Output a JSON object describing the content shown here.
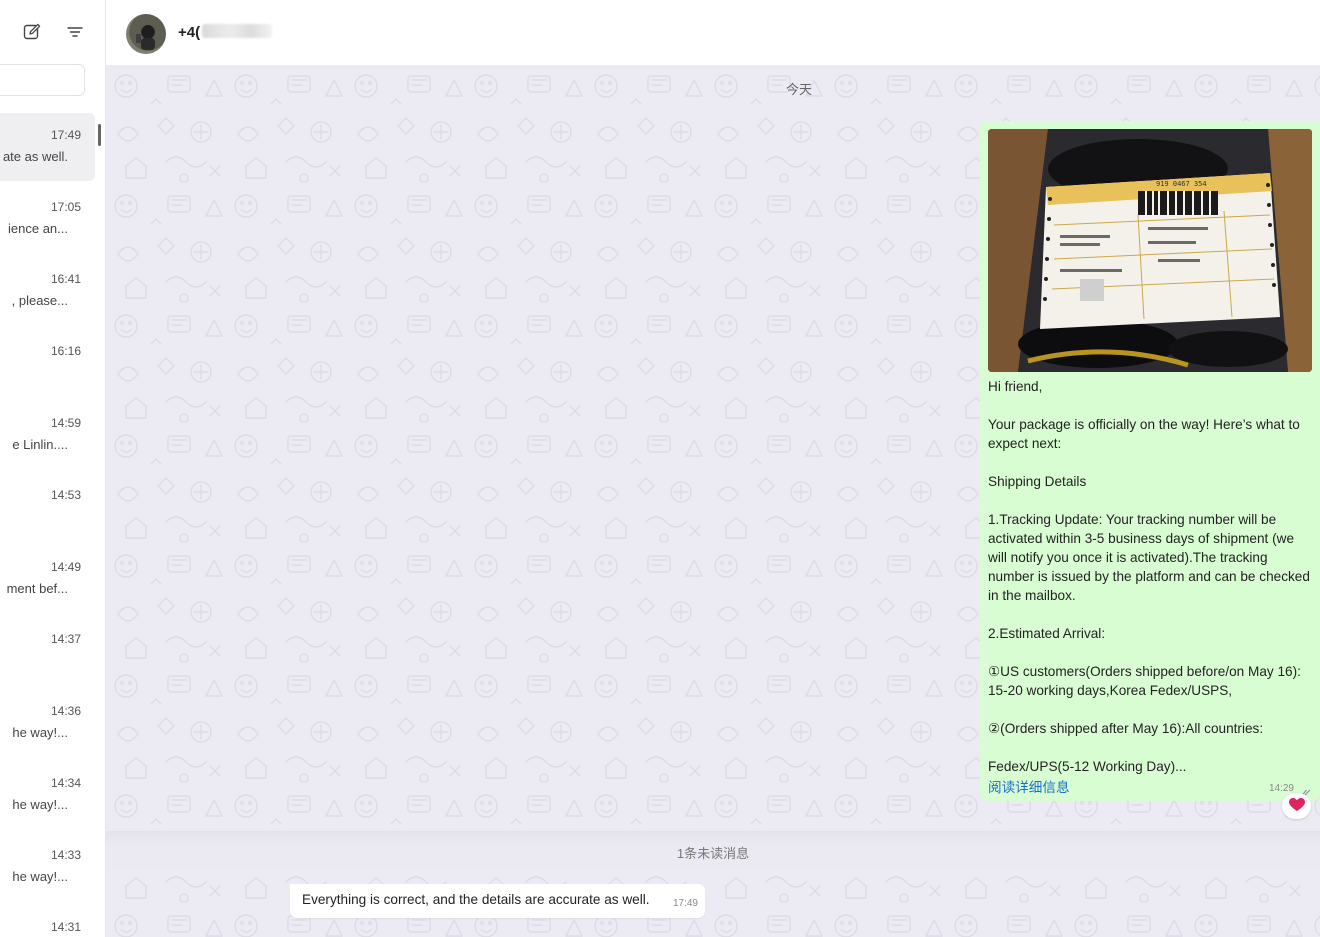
{
  "sidebar": {
    "search": {
      "value": "",
      "placeholder": ""
    },
    "chats": [
      {
        "time": "17:49",
        "preview": "ate as well."
      },
      {
        "time": "17:05",
        "preview": "ience an..."
      },
      {
        "time": "16:41",
        "preview": ", please..."
      },
      {
        "time": "16:16",
        "preview": ""
      },
      {
        "time": "14:59",
        "preview": "e Linlin...."
      },
      {
        "time": "14:53",
        "preview": ""
      },
      {
        "time": "14:49",
        "preview": "ment bef..."
      },
      {
        "time": "14:37",
        "preview": ""
      },
      {
        "time": "14:36",
        "preview": "he way!..."
      },
      {
        "time": "14:34",
        "preview": "he way!..."
      },
      {
        "time": "14:33",
        "preview": "he way!..."
      },
      {
        "time": "14:31",
        "preview": ""
      }
    ]
  },
  "header": {
    "contact_name": "+4("
  },
  "chat": {
    "date_divider": "今天",
    "outgoing": {
      "text": "Hi friend,\n\nYour package is officially on the way!  Here’s what to expect next:\n\nShipping Details\n\n1.Tracking Update: Your tracking number will be activated within 3-5 business days of shipment (we will notify you once it is activated).The tracking number is issued by the platform and can be checked in the mailbox.\n\n2.Estimated Arrival:\n\n①US customers(Orders shipped before/on May 16): 15-20 working days,Korea Fedex/USPS,\n\n②(Orders shipped after May 16):All countries:\n\nFedex/UPS(5-12 Working Day)...",
      "read_more": "阅读详细信息",
      "time": "14:29",
      "reaction": "heart-icon",
      "photo_label": "919 0467 354"
    },
    "unread_divider": "1条未读消息",
    "incoming": {
      "text": "Everything is correct, and the details are accurate as well.",
      "time": "17:49"
    }
  },
  "colors": {
    "outgoing_bubble": "#d9fdd3",
    "chat_background": "#ecebf3",
    "link": "#1a6fc9",
    "reaction": "#e0245e"
  }
}
